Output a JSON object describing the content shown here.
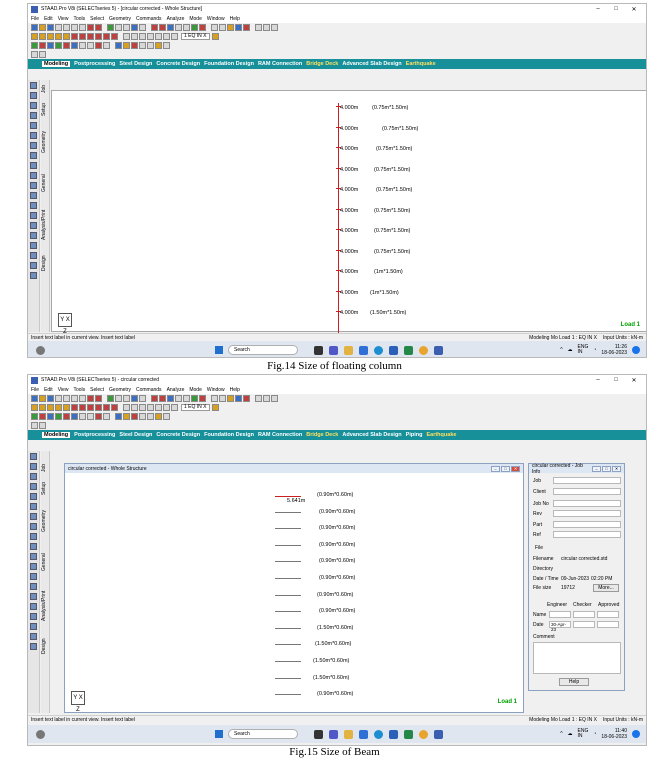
{
  "app": {
    "icon": "staad-app-icon",
    "menu": [
      "File",
      "Edit",
      "View",
      "Tools",
      "Select",
      "Geometry",
      "Commands",
      "Analyze",
      "Mode",
      "Window",
      "Help"
    ],
    "tabs": [
      "Modeling",
      "Postprocessing",
      "Steel Design",
      "Concrete Design",
      "Foundation Design",
      "RAM Connection",
      "Bridge Deck",
      "Advanced Slab Design",
      "Piping",
      "Earthquake"
    ],
    "side_tabs": [
      "Setup",
      "Geometry",
      "General",
      "Analysis/Print",
      "Design"
    ],
    "load_case": "1 EQ IN X",
    "axis_label": "Y\nX\nZ",
    "load_label": "Load 1",
    "window_controls": [
      "–",
      "□",
      "✕"
    ]
  },
  "screenshot1": {
    "title": "STAAD.Pro V8i (SELECTseries 5) - [circular corrected - Whole Structure]",
    "side_tab_extra": "Job",
    "column_lengths": [
      "4.000m",
      "4.000m",
      "4.000m",
      "4.000m",
      "4.000m",
      "4.000m",
      "4.000m",
      "4.000m",
      "4.000m",
      "4.000m",
      "4.000m"
    ],
    "column_sections": [
      "(0.75m*1.50m)",
      "(0.75m*1.50m)",
      "(0.75m*1.50m)",
      "(0.75m*1.50m)",
      "(0.75m*1.50m)",
      "(0.75m*1.50m)",
      "(0.75m*1.50m)",
      "(0.75m*1.50m)",
      "(1m*1.50m)",
      "(1m*1.50m)",
      "(1.50m*1.50m)"
    ],
    "status_left": "Insert text label in current view. Insert text label",
    "status_mid": "Modeling Mo  Load 1 : EQ IN X",
    "status_right": "Input Units : kN-m",
    "taskbar": {
      "search": "Search",
      "lang": "ENG\nIN",
      "time": "11:26",
      "date": "18-06-2023"
    }
  },
  "caption1": "Fig.14 Size of floating column",
  "screenshot2": {
    "title": "STAAD.Pro V8i (SELECTseries 5) - circular corrected",
    "side_tab_extra": "Job",
    "inner_window_title": "circular corrected - Whole Structure",
    "dimension_label": "5.641m",
    "beam_sections": [
      "(0.90m*0.60m)",
      "(0.90m*0.60m)",
      "(0.90m*0.60m)",
      "(0.90m*0.60m)",
      "(0.90m*0.60m)",
      "(0.90m*0.60m)",
      "(0.90m*0.60m)",
      "(0.90m*0.60m)",
      "(1.50m*0.60m)",
      "(1.50m*0.60m)",
      "(1.50m*0.60m)",
      "(1.50m*0.60m)",
      "(0.90m*0.60m)"
    ],
    "job_info": {
      "title": "circular corrected - Job Info",
      "fields": [
        "Job",
        "Client",
        "Job No",
        "Rev",
        "Part",
        "Ref"
      ],
      "file_heading": "File",
      "filename_label": "Filename",
      "filename": "circular corrected.std",
      "directory_label": "Directory",
      "datetime_label": "Date / Time",
      "date": "09-Jun-2023",
      "time": "02:20 PM",
      "filesize_label": "File size",
      "filesize": "19712",
      "more_button": "More...",
      "engineer": "Engineer",
      "checker": "Checker",
      "approved": "Approved",
      "name_label": "Name",
      "date_label": "Date",
      "date_value": "30-Apr-23",
      "comment_label": "Comment",
      "help_button": "Help"
    },
    "status_left": "Insert text label in current view. Insert text label",
    "status_mid": "Modeling Mo  Load 1 : EQ IN X",
    "status_right": "Input Units : kN-m",
    "taskbar": {
      "search": "Search",
      "lang": "ENG\nIN",
      "time": "11:40",
      "date": "18-06-2023"
    }
  },
  "caption2": "Fig.15 Size of Beam"
}
